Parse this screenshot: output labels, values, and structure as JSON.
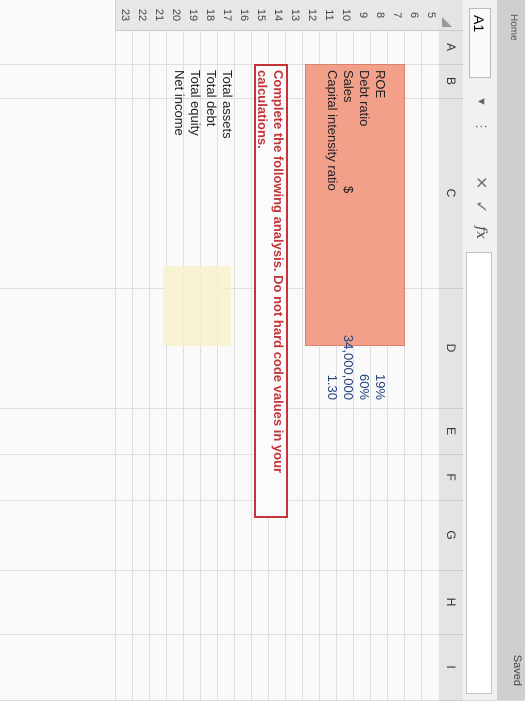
{
  "window": {
    "saved_label": "Saved",
    "ribbon_fragment": "Home"
  },
  "formula_bar": {
    "name_box": "A1",
    "cancel_icon": "✕",
    "enter_icon": "✓",
    "fx_label": "fx"
  },
  "columns": [
    "A",
    "B",
    "C",
    "D",
    "E",
    "F",
    "G",
    "H",
    "I"
  ],
  "rows": [
    "5",
    "6",
    "7",
    "8",
    "9",
    "10",
    "11",
    "12",
    "13",
    "14",
    "15",
    "16",
    "17",
    "18",
    "19",
    "20",
    "21",
    "22",
    "23"
  ],
  "given": {
    "roe_label": "ROE",
    "roe_value": "19%",
    "debt_ratio_label": "Debt ratio",
    "debt_ratio_value": "60%",
    "sales_label": "Sales",
    "sales_currency": "$",
    "sales_value": "34,000,000",
    "capital_intensity_label": "Capital intensity ratio",
    "capital_intensity_value": "1.30"
  },
  "instruction": {
    "line1": "Complete the following analysis. Do not hard code values in your",
    "line2": "calculations."
  },
  "analysis": {
    "total_assets_label": "Total assets",
    "total_debt_label": "Total debt",
    "total_equity_label": "Total equity",
    "net_income_label": "Net income"
  },
  "colors": {
    "highlight": "#f2a08a",
    "instruction_border": "#c2343a",
    "input_cell": "#f7f1c9"
  }
}
